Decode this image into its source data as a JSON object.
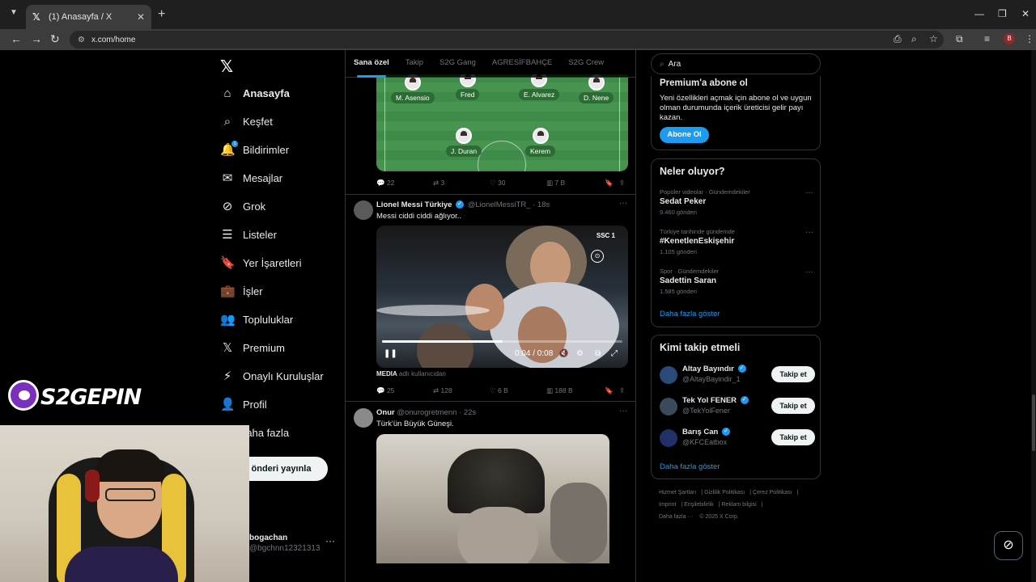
{
  "browser": {
    "tab_title": "(1) Anasayfa / X",
    "url": "x.com/home",
    "profile_initial": "B"
  },
  "nav": {
    "items": [
      {
        "label": "Anasayfa",
        "icon": "home-icon",
        "glyph": "⌂"
      },
      {
        "label": "Keşfet",
        "icon": "search-icon",
        "glyph": "⌕"
      },
      {
        "label": "Bildirimler",
        "icon": "bell-icon",
        "glyph": "🔔"
      },
      {
        "label": "Mesajlar",
        "icon": "envelope-icon",
        "glyph": "✉"
      },
      {
        "label": "Grok",
        "icon": "grok-icon",
        "glyph": "⊘"
      },
      {
        "label": "Listeler",
        "icon": "list-icon",
        "glyph": "☰"
      },
      {
        "label": "Yer İşaretleri",
        "icon": "bookmark-icon",
        "glyph": "🔖"
      },
      {
        "label": "İşler",
        "icon": "briefcase-icon",
        "glyph": "💼"
      },
      {
        "label": "Topluluklar",
        "icon": "people-icon",
        "glyph": "👥"
      },
      {
        "label": "Premium",
        "icon": "x-logo-icon",
        "glyph": "𝕏"
      },
      {
        "label": "Onaylı Kuruluşlar",
        "icon": "lightning-icon",
        "glyph": "⚡"
      },
      {
        "label": "Profil",
        "icon": "person-icon",
        "glyph": "👤"
      },
      {
        "label": "raha fazla",
        "icon": "more-icon",
        "glyph": ""
      }
    ],
    "notification_count": "1",
    "post_button": "önderi yayınla",
    "account_name": "bogachan",
    "account_handle": "@bgchnn12321313"
  },
  "timeline": {
    "tabs": [
      "Sana özel",
      "Takip",
      "S2G Gang",
      "AGRESİFBAHÇE",
      "S2G Crew"
    ],
    "lineup": {
      "players": [
        "M. Asensio",
        "Fred",
        "E. Alvarez",
        "D. Nene",
        "J. Duran",
        "Kerem"
      ]
    },
    "tweet1_stats": {
      "replies": "22",
      "reposts": "3",
      "likes": "30",
      "views": "7 B"
    },
    "tweet2": {
      "name": "Lionel Messi Türkiye",
      "handle": "@LionelMessiTR_",
      "time": "· 18s",
      "text": "Messi ciddi ciddi ağlıyor..",
      "video_time": "0:04 / 0:08",
      "video_progress": 0.5,
      "channel_logo": "SSC 1",
      "media_label": "MEDIA",
      "media_source": "adlı kullanıcıdan",
      "stats": {
        "replies": "25",
        "reposts": "128",
        "likes": "6 B",
        "views": "188 B"
      }
    },
    "tweet3": {
      "name": "Onur",
      "handle": "@onurogretmenn",
      "time": "· 22s",
      "text": "Türk'ün Büyük Güneşi."
    }
  },
  "sidebar": {
    "search_placeholder": "Ara",
    "premium": {
      "title": "Premium'a abone ol",
      "body": "Yeni özellikleri açmak için abone ol ve uygun olman durumunda içerik üreticisi gelir payı kazan.",
      "button": "Abone Ol"
    },
    "trends_title": "Neler oluyor?",
    "trends": [
      {
        "context": "Popüler videolar · Gündemdekiler",
        "title": "Sedat Peker",
        "count": "9.460 gönderi"
      },
      {
        "context": "Türkiye tarihinde gündemde",
        "title": "#KenetlenEskişehir",
        "count": "1.105 gönderi"
      },
      {
        "context": "Spor · Gündemdekiler",
        "title": "Sadettin Saran",
        "count": "1.585 gönderi"
      }
    ],
    "show_more": "Daha fazla göster",
    "who_to_follow_title": "Kimi takip etmeli",
    "who_to_follow": [
      {
        "name": "Altay Bayındır",
        "handle": "@AltayBayindir_1",
        "button": "Takip et"
      },
      {
        "name": "Tek Yol FENER",
        "handle": "@TekYolFener",
        "button": "Takip et"
      },
      {
        "name": "Barış Can",
        "handle": "@KFCEatbox",
        "button": "Takip et"
      }
    ],
    "footer": [
      "Hizmet Şartları",
      "Gizlilik Politikası",
      "Çerez Politikası",
      "Imprint",
      "Erişilebilirlik",
      "Reklam bilgisi",
      "Daha fazla ···",
      "© 2025 X Corp."
    ]
  },
  "overlay": {
    "brand": "S2GEPIN"
  },
  "colors": {
    "accent": "#1d9bf0",
    "background": "#000000",
    "border": "#2f3336",
    "muted_text": "#71767b"
  }
}
